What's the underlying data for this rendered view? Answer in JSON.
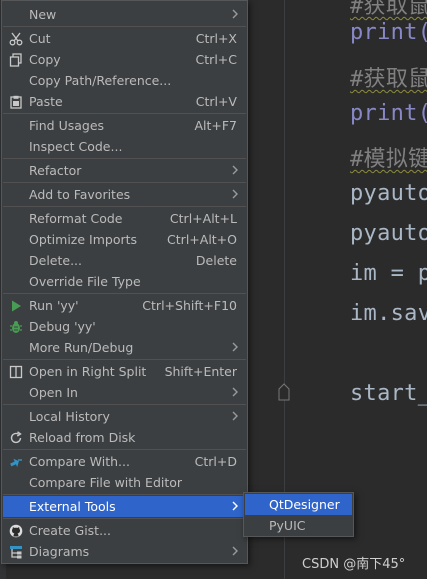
{
  "editor": {
    "lines": [
      {
        "text": "#获取鼠",
        "kind": "comment"
      },
      {
        "text": "print(",
        "kind": "fn"
      },
      {
        "text": "#获取鼠",
        "kind": "comment"
      },
      {
        "text": "print(",
        "kind": "fn"
      },
      {
        "text": "#模拟键",
        "kind": "comment"
      },
      {
        "text": "pyauto",
        "kind": "code"
      },
      {
        "text": "pyauto",
        "kind": "code"
      },
      {
        "text": "im = p",
        "kind": "code"
      },
      {
        "text": "im.sav",
        "kind": "code"
      },
      {
        "text": "start_",
        "kind": "code"
      }
    ]
  },
  "menu": {
    "items": [
      {
        "id": "new",
        "label": "New",
        "submenu": true
      },
      {
        "id": "cut",
        "label": "Cut",
        "shortcut": "Ctrl+X",
        "icon": "scissors-icon"
      },
      {
        "id": "copy",
        "label": "Copy",
        "shortcut": "Ctrl+C",
        "icon": "copy-icon"
      },
      {
        "id": "copy-path",
        "label": "Copy Path/Reference..."
      },
      {
        "id": "paste",
        "label": "Paste",
        "shortcut": "Ctrl+V",
        "icon": "clipboard-icon"
      },
      {
        "id": "find-usages",
        "label": "Find Usages",
        "shortcut": "Alt+F7"
      },
      {
        "id": "inspect-code",
        "label": "Inspect Code..."
      },
      {
        "id": "refactor",
        "label": "Refactor",
        "submenu": true
      },
      {
        "id": "add-favorites",
        "label": "Add to Favorites",
        "submenu": true
      },
      {
        "id": "reformat-code",
        "label": "Reformat Code",
        "shortcut": "Ctrl+Alt+L"
      },
      {
        "id": "optimize-imports",
        "label": "Optimize Imports",
        "shortcut": "Ctrl+Alt+O"
      },
      {
        "id": "delete",
        "label": "Delete...",
        "shortcut": "Delete"
      },
      {
        "id": "override-file-type",
        "label": "Override File Type"
      },
      {
        "id": "run",
        "label": "Run 'yy'",
        "shortcut": "Ctrl+Shift+F10",
        "icon": "run-icon"
      },
      {
        "id": "debug",
        "label": "Debug 'yy'",
        "icon": "debug-bug-icon"
      },
      {
        "id": "more-run-debug",
        "label": "More Run/Debug",
        "submenu": true
      },
      {
        "id": "open-right-split",
        "label": "Open in Right Split",
        "shortcut": "Shift+Enter",
        "icon": "split-icon"
      },
      {
        "id": "open-in",
        "label": "Open In",
        "submenu": true
      },
      {
        "id": "local-history",
        "label": "Local History",
        "submenu": true
      },
      {
        "id": "reload-disk",
        "label": "Reload from Disk",
        "icon": "reload-icon"
      },
      {
        "id": "compare-with",
        "label": "Compare With...",
        "shortcut": "Ctrl+D",
        "icon": "compare-icon"
      },
      {
        "id": "compare-editor",
        "label": "Compare File with Editor"
      },
      {
        "id": "external-tools",
        "label": "External Tools",
        "submenu": true,
        "selected": true
      },
      {
        "id": "create-gist",
        "label": "Create Gist...",
        "icon": "github-icon"
      },
      {
        "id": "diagrams",
        "label": "Diagrams",
        "submenu": true,
        "icon": "diagram-icon"
      }
    ]
  },
  "submenu": {
    "items": [
      {
        "label": "QtDesigner",
        "selected": true
      },
      {
        "label": "PyUIC"
      }
    ]
  },
  "watermark": "CSDN @南下45°",
  "colors": {
    "menu_bg": "#3c3f41",
    "selection": "#2f65ca",
    "editor_bg": "#2b2b2b",
    "run_green": "#499c54"
  }
}
